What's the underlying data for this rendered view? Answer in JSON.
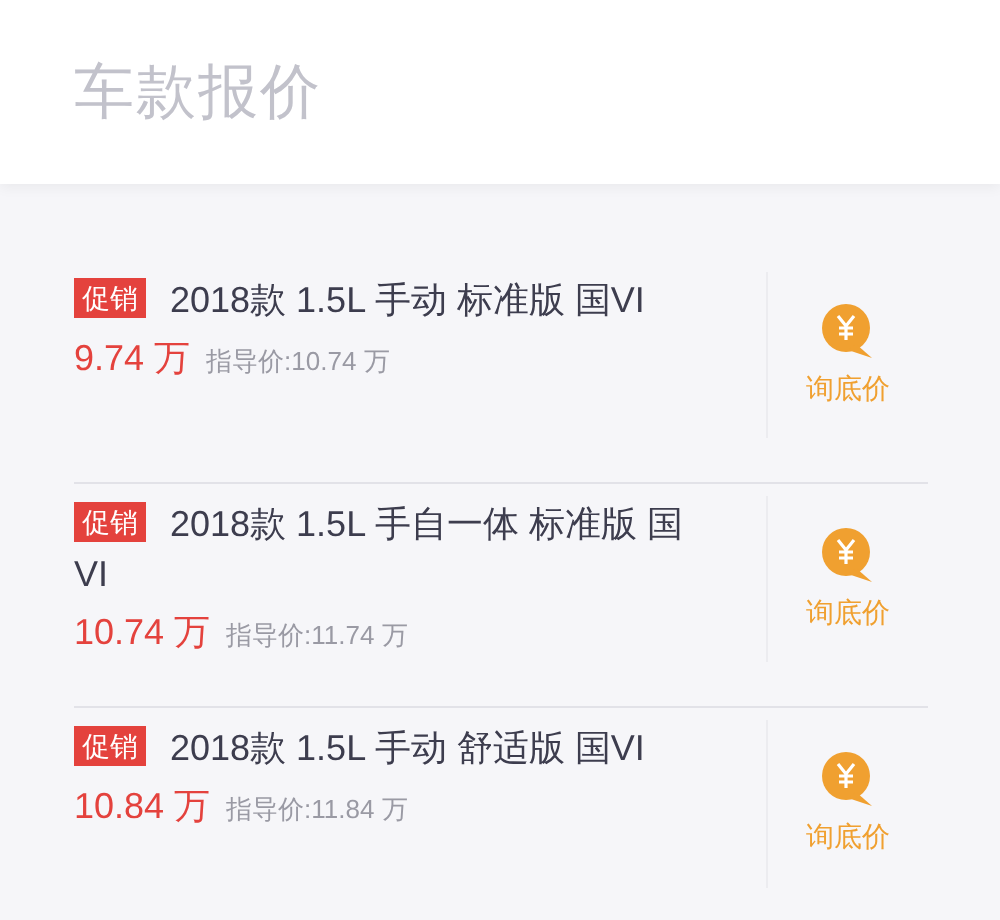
{
  "header": {
    "title": "车款报价"
  },
  "items": [
    {
      "badge": "促销",
      "name": "2018款 1.5L 手动 标准版 国VI",
      "price": "9.74 万",
      "guide_price": "指导价:10.74 万",
      "action": "询底价"
    },
    {
      "badge": "促销",
      "name": "2018款 1.5L 手自一体 标准版 国VI",
      "price": "10.74 万",
      "guide_price": "指导价:11.74 万",
      "action": "询底价"
    },
    {
      "badge": "促销",
      "name": "2018款 1.5L 手动 舒适版 国VI",
      "price": "10.84 万",
      "guide_price": "指导价:11.84 万",
      "action": "询底价"
    }
  ]
}
